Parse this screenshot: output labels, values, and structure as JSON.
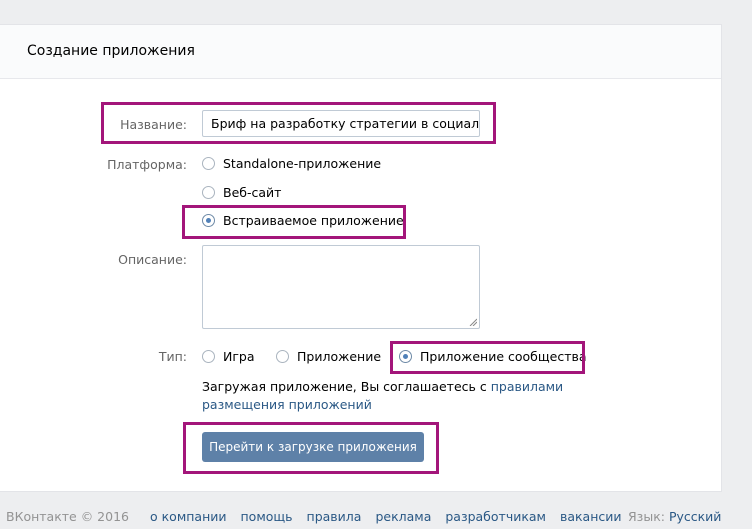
{
  "page": {
    "title": "Создание приложения"
  },
  "form": {
    "name_label": "Название:",
    "name_value": "Бриф на разработку стратегии в социальн",
    "platform_label": "Платформа:",
    "platform_options": [
      "Standalone-приложение",
      "Веб-сайт",
      "Встраиваемое приложение"
    ],
    "platform_selected": "Встраиваемое приложение",
    "description_label": "Описание:",
    "description_value": "",
    "type_label": "Тип:",
    "type_options": [
      "Игра",
      "Приложение",
      "Приложение сообщества"
    ],
    "type_selected": "Приложение сообщества",
    "terms_text": "Загружая приложение, Вы соглашаетесь с ",
    "terms_link": "правилами размещения приложений",
    "submit_label": "Перейти к загрузке приложения"
  },
  "footer": {
    "copyright": "ВКонтакте © 2016",
    "links": [
      "о компании",
      "помощь",
      "правила",
      "реклама",
      "разработчикам",
      "вакансии"
    ],
    "language_label": "Язык:",
    "language_value": "Русский"
  },
  "colors": {
    "highlight": "#a3157a",
    "button": "#5e81a8",
    "link": "#2a5885",
    "background": "#edeef0"
  }
}
